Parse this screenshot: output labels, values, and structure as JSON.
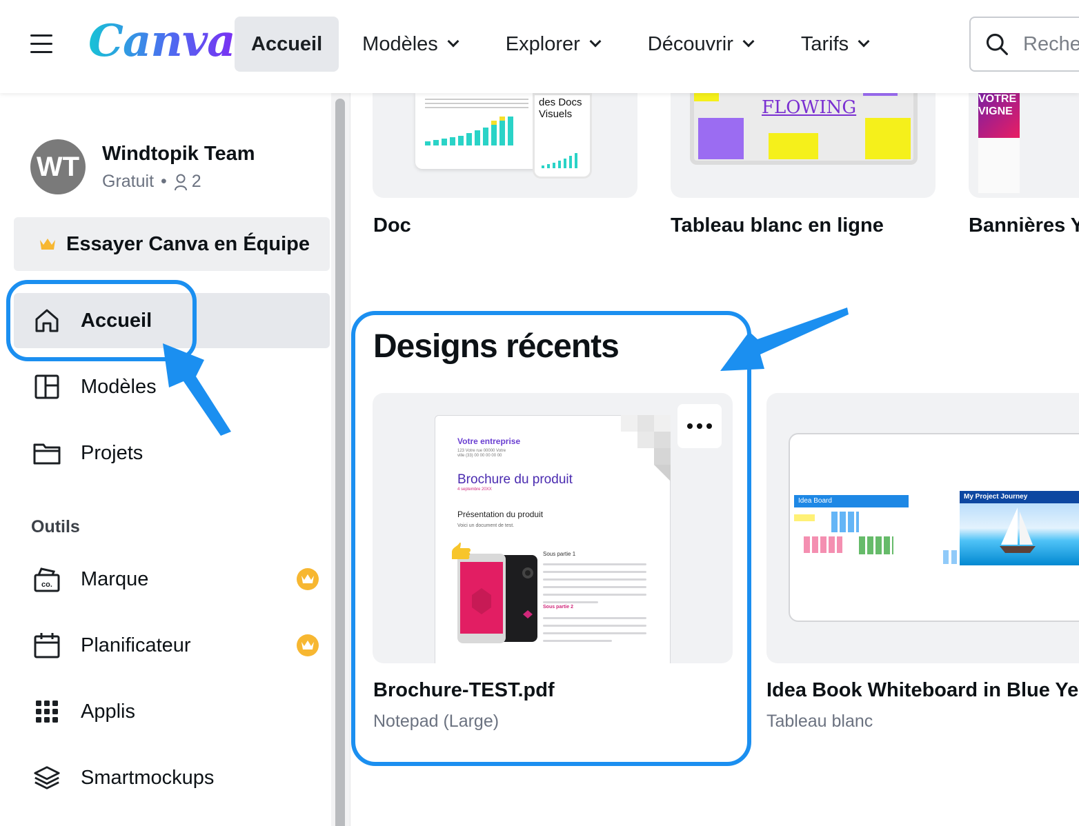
{
  "header": {
    "logo": "Canva",
    "nav": [
      {
        "label": "Accueil",
        "active": true,
        "dropdown": false
      },
      {
        "label": "Modèles",
        "active": false,
        "dropdown": true
      },
      {
        "label": "Explorer",
        "active": false,
        "dropdown": true
      },
      {
        "label": "Découvrir",
        "active": false,
        "dropdown": true
      },
      {
        "label": "Tarifs",
        "active": false,
        "dropdown": true
      }
    ],
    "search_placeholder": "Reche"
  },
  "sidebar": {
    "avatar_initials": "WT",
    "team_name": "Windtopik Team",
    "plan": "Gratuit",
    "members": "2",
    "try_team": "Essayer Canva en Équipe",
    "items": [
      {
        "label": "Accueil",
        "icon": "home-icon",
        "active": true
      },
      {
        "label": "Modèles",
        "icon": "layout-icon",
        "active": false
      },
      {
        "label": "Projets",
        "icon": "folder-icon",
        "active": false
      }
    ],
    "tools_label": "Outils",
    "tools": [
      {
        "label": "Marque",
        "icon": "brand-kit-icon",
        "premium": true
      },
      {
        "label": "Planificateur",
        "icon": "calendar-icon",
        "premium": true
      },
      {
        "label": "Applis",
        "icon": "apps-grid-icon",
        "premium": false
      },
      {
        "label": "Smartmockups",
        "icon": "layers-icon",
        "premium": false
      }
    ]
  },
  "templates": [
    {
      "label": "Doc",
      "preview_text": "des Docs Visuels"
    },
    {
      "label": "Tableau blanc en ligne",
      "preview_text": "FLOWING"
    },
    {
      "label": "Bannières Y",
      "preview_text": "VOTRE VIGNE"
    }
  ],
  "recent_designs": {
    "title": "Designs récents",
    "items": [
      {
        "title": "Brochure-TEST.pdf",
        "subtitle": "Notepad (Large)",
        "preview": {
          "company": "Votre entreprise",
          "address": "123 Votre rue 00000 Votre ville (33) 00 00 00 00 00",
          "doc_title": "Brochure du produit",
          "date": "4 septembre 20XX",
          "heading": "Présentation du produit",
          "paragraph": "Voici un document de test.",
          "sub1": "Sous partie 1",
          "sub2": "Sous partie 2"
        }
      },
      {
        "title": "Idea Book Whiteboard in Blue Yell",
        "subtitle": "Tableau blanc",
        "preview": {
          "board1": "Idea Board",
          "board2": "My Project Journey"
        }
      }
    ]
  },
  "colors": {
    "accent_highlight": "#1b8ff0",
    "premium_gold": "#f7b731",
    "active_bg": "#e6e8ec"
  }
}
